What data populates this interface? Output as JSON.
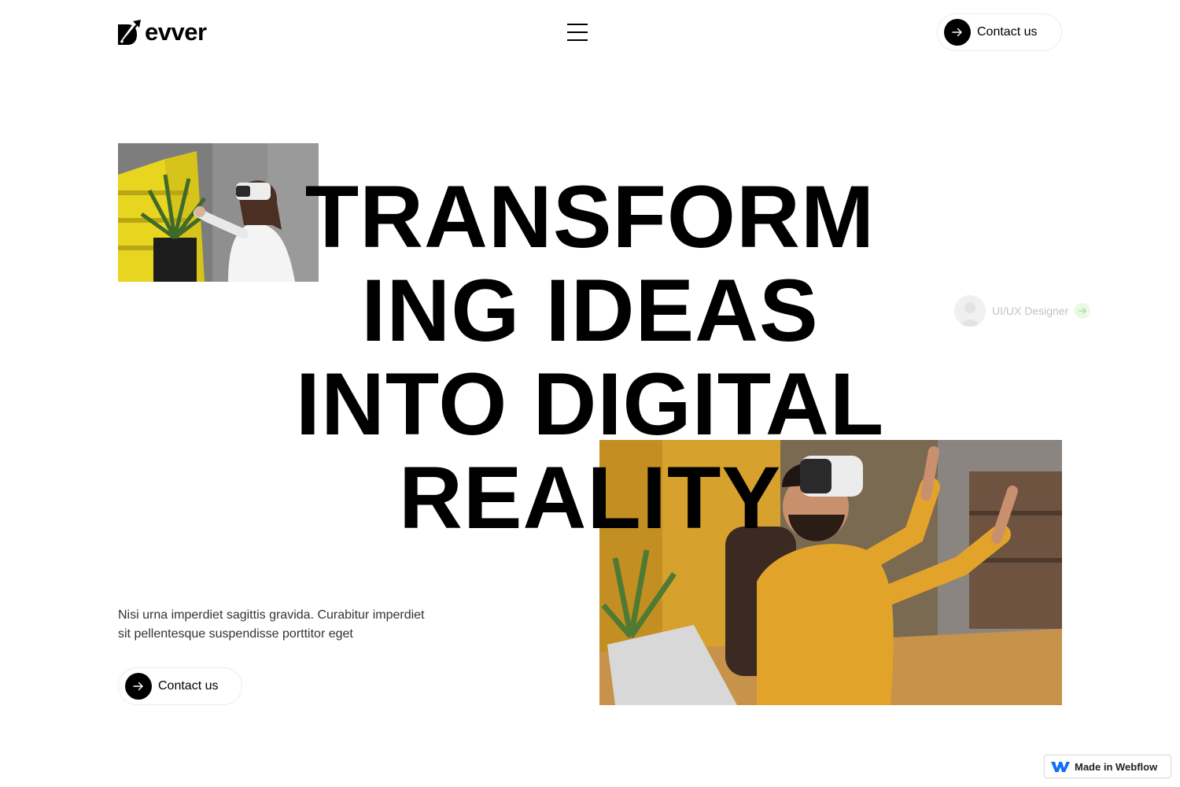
{
  "header": {
    "logo_text": "evver",
    "contact_label": "Contact us"
  },
  "hero": {
    "headline_lines": [
      "TRANSFORM",
      "ING IDEAS",
      "INTO DIGITAL",
      "REALITY"
    ],
    "description": "Nisi urna imperdiet sagittis gravida. Curabitur imperdiet sit pellentesque suspendisse porttitor eget",
    "cta_label": "Contact us"
  },
  "profile_chip": {
    "role": "UI/UX Designer"
  },
  "badge": {
    "text": "Made in Webflow"
  },
  "icons": {
    "logo": "logo-mark-icon",
    "menu": "hamburger-menu-icon",
    "arrow": "arrow-right-icon",
    "webflow": "webflow-logo-icon"
  },
  "colors": {
    "text": "#000000",
    "accent_green": "#b9f0a6",
    "yellow": "#e8d51f",
    "mustard": "#d6a12d"
  }
}
